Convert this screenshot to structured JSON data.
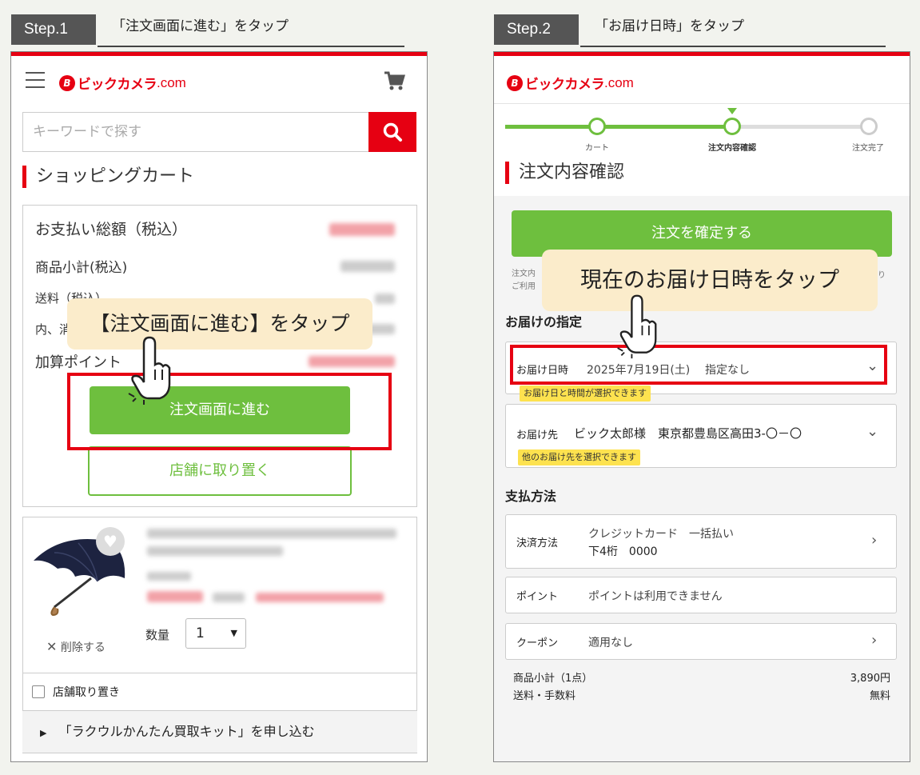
{
  "step1": {
    "tab": "Step.1",
    "title": "「注文画面に進む」をタップ",
    "logo_com": ".com",
    "search_placeholder": "キーワードで探す",
    "heading": "ショッピングカート",
    "summary": {
      "total_label": "お支払い総額（税込）",
      "subtotal_label": "商品小計(税込)",
      "shipping_label": "送料（税込）",
      "breakdown_label": "内、消",
      "points_label": "加算ポイント"
    },
    "callout": "【注文画面に進む】をタップ",
    "order_button": "注文画面に進む",
    "store_button": "店舗に取り置く",
    "quantity_label": "数量",
    "quantity_value": "1",
    "delete_label": "削除する",
    "store_reserve_label": "店舗取り置き",
    "kit_link": "「ラクウルかんたん買取キット」を申し込む"
  },
  "step2": {
    "tab": "Step.2",
    "title": "「お届け日時」をタップ",
    "logo_com": ".com",
    "progress": [
      "カート",
      "注文内容確認",
      "注文完了"
    ],
    "heading": "注文内容確認",
    "confirm_button": "注文を確定する",
    "fine_print_1": "注文内",
    "fine_print_2": "ご利用",
    "fine_print_3": "り",
    "callout": "現在のお届け日時をタップ",
    "delivery_section": "お届けの指定",
    "delivery_date": {
      "label": "お届け日時",
      "value": "2025年7月19日(土)",
      "time": "指定なし",
      "tooltip": "お届け日と時間が選択できます"
    },
    "delivery_address": {
      "label": "お届け先",
      "value": "ビック太郎様　東京都豊島区高田3-〇－〇",
      "tooltip": "他のお届け先を選択できます"
    },
    "payment_section": "支払方法",
    "payment": {
      "label": "決済方法",
      "value1": "クレジットカード　一括払い",
      "value2": "下4桁　0000"
    },
    "points": {
      "label": "ポイント",
      "value": "ポイントは利用できません"
    },
    "coupon": {
      "label": "クーポン",
      "value": "適用なし"
    },
    "subtotal_label": "商品小計（1点）",
    "subtotal_value": "3,890円",
    "shipping_label": "送料・手数料",
    "shipping_value": "無料"
  },
  "colors": {
    "brand_red": "#e60012",
    "green": "#6ebf3e",
    "callout": "#fbeccb",
    "tooltip": "#fde24f"
  }
}
